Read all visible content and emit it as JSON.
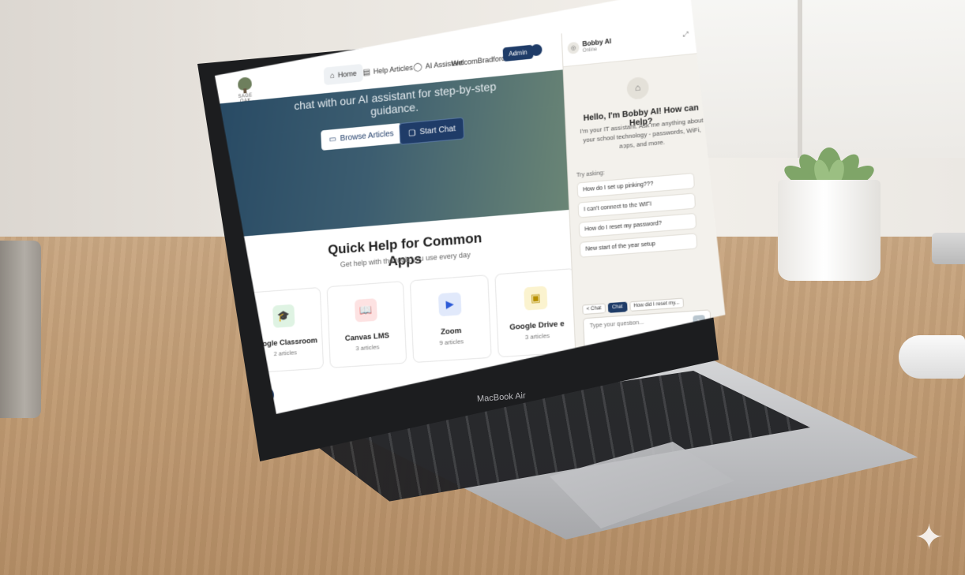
{
  "brand": {
    "device_label": "MacBook Air",
    "logo_text": "SAGE OAK"
  },
  "nav": {
    "home": "Home",
    "help_articles": "Help Articles",
    "ai_assistant": "AI Assistant",
    "welcome_user": "WelcomBradford Booker",
    "admin": "Admin"
  },
  "hero": {
    "text": "chat with our AI assistant for step-by-step guidance.",
    "browse_label": "Browse Articles",
    "chat_label": "Start Chat"
  },
  "quick_help": {
    "title": "Quick Help for Common Apps",
    "subtitle": "Get help with the tools you use every day",
    "cards": [
      {
        "name": "Google Classroom",
        "count": "2 articles",
        "icon": "graduation-cap-icon",
        "bg": "#dff3e3",
        "color": "#2f8a4c"
      },
      {
        "name": "Canvas LMS",
        "count": "3 articles",
        "icon": "book-icon",
        "bg": "#fde2e2",
        "color": "#c0392b"
      },
      {
        "name": "Zoom",
        "count": "9 articles",
        "icon": "video-icon",
        "bg": "#e1e9fb",
        "color": "#2d5bd7"
      },
      {
        "name": "Google Drive e",
        "count": "3 articles",
        "icon": "drive-icon",
        "bg": "#fbf3cf",
        "color": "#b78f00"
      }
    ]
  },
  "chat": {
    "name": "Bobby AI",
    "status": "Online",
    "greeting": "Hello, I'm Bobby AI! How can Help?",
    "intro": "I'm your IT assistant. Ask me anything about your school technology - passwords, WiFi, apps, and more.",
    "try_asking": "Try asking:",
    "suggestions": [
      "How do I set up pinking???",
      "I can't connect to the WIFI",
      "How do I reset my password?",
      "New start of the year setup"
    ],
    "tabs": [
      "< Chat",
      "Chat",
      "How did I reset my..."
    ],
    "input_placeholder": "Type your question...",
    "enter_hint": "Enter to send",
    "counter": "0 / 2,000"
  }
}
